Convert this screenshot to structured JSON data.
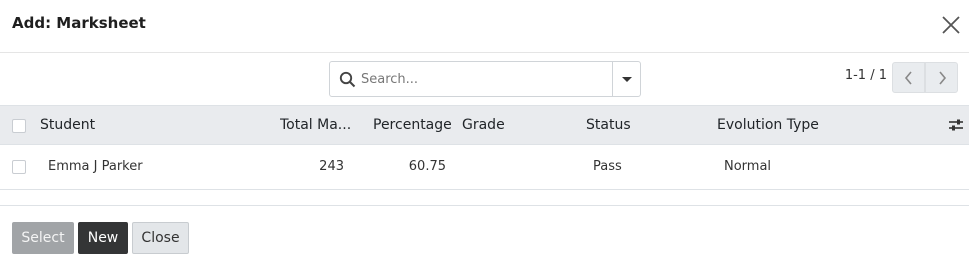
{
  "dialog": {
    "title": "Add: Marksheet"
  },
  "search": {
    "placeholder": "Search...",
    "value": ""
  },
  "pager": {
    "text": "1-1 / 1"
  },
  "table": {
    "columns": [
      "Student",
      "Total Ma...",
      "Percentage",
      "Grade",
      "Status",
      "Evolution Type"
    ],
    "rows": [
      {
        "student": "Emma J Parker",
        "total_marks": "243",
        "percentage": "60.75",
        "grade": "",
        "status": "Pass",
        "evolution_type": "Normal"
      }
    ]
  },
  "footer": {
    "select_label": "Select",
    "new_label": "New",
    "close_label": "Close"
  },
  "icons": {
    "close": "close-icon",
    "search": "search-icon",
    "dropdown": "caret-down-icon",
    "prev": "chevron-left-icon",
    "next": "chevron-right-icon",
    "settings": "sliders-icon"
  },
  "colors": {
    "header_bg": "#e9ebee",
    "primary_button": "#343536",
    "disabled_button": "#a1a4a7",
    "secondary_button": "#e3e6e9"
  }
}
